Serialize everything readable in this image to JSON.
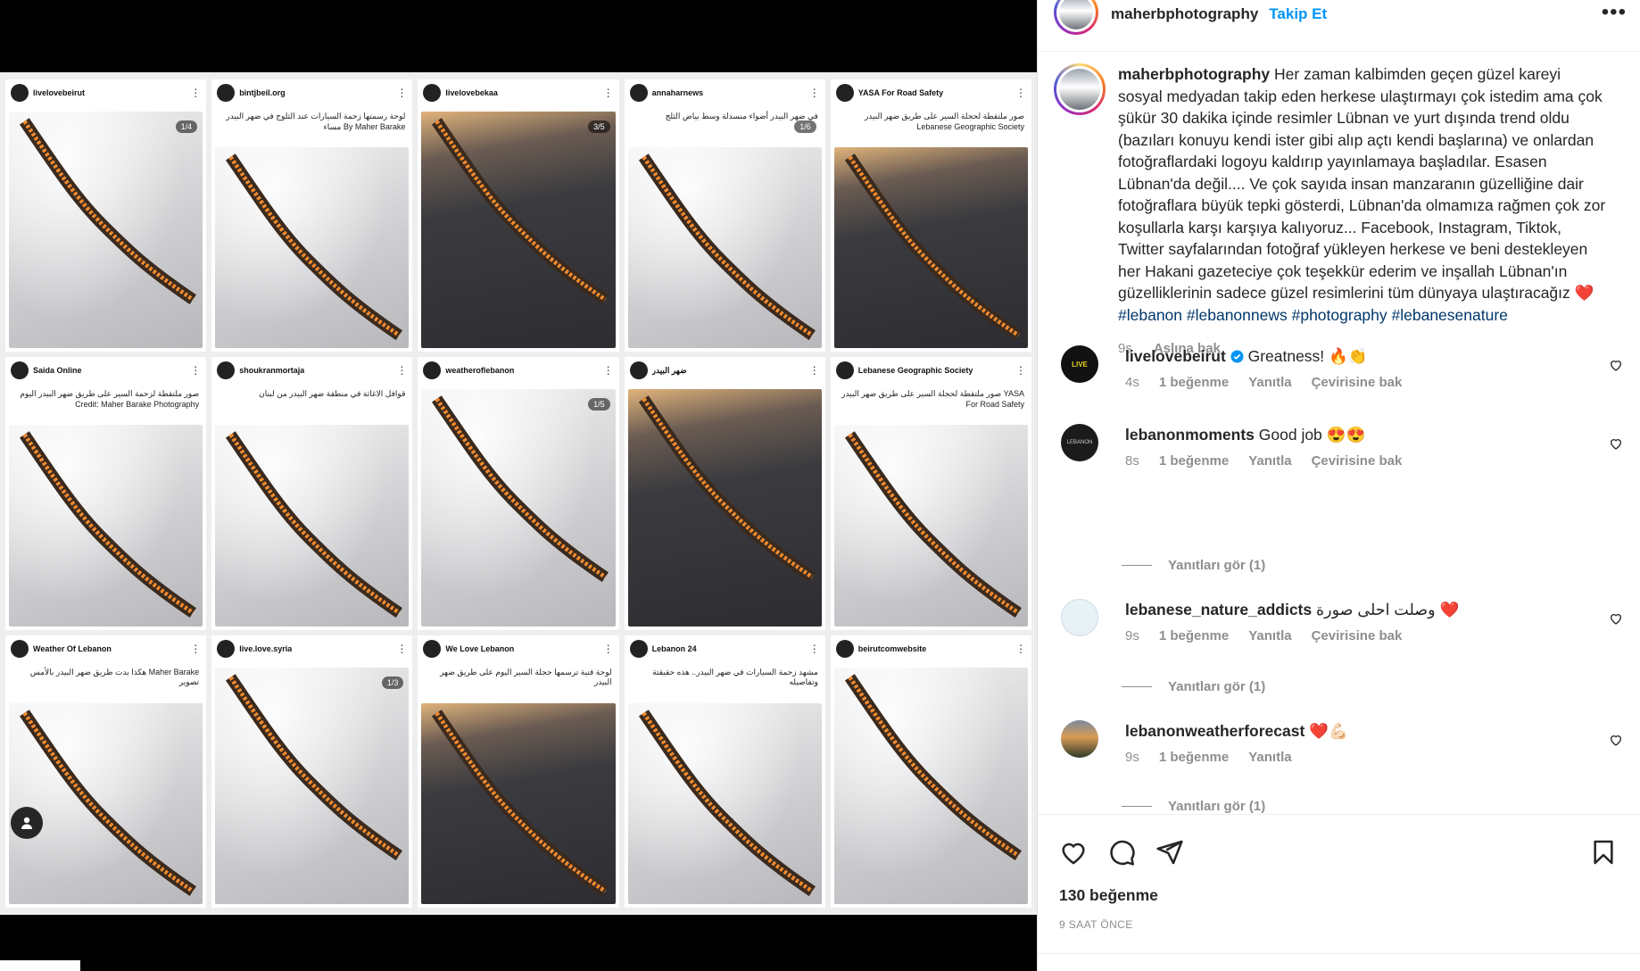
{
  "post": {
    "author": "maherbphotography",
    "follow_label": "Takip Et",
    "more_icon": "•••",
    "caption_text": " Her zaman kalbimden geçen güzel kareyi sosyal medyadan takip eden herkese ulaştırmayı çok istedim ama çok şükür 30 dakika içinde resimler Lübnan ve yurt dışında trend oldu (bazıları konuyu kendi ister gibi alıp açtı kendi başlarına) ve onlardan fotoğraflardaki logoyu kaldırıp yayınlamaya başladılar. Esasen Lübnan'da değil.... Ve çok sayıda insan manzaranın güzelliğine dair fotoğraflara büyük tepki gösterdi, Lübnan'da olmamıza rağmen çok zor koşullarla karşı karşıya kalıyoruz... Facebook, Instagram, Tiktok, Twitter sayfalarından fotoğraf yükleyen herkese ve beni destekleyen her Hakani gazeteciye çok teşekkür ederim ve inşallah Lübnan'ın güzelliklerinin sadece güzel resimlerini tüm dünyaya ulaştıracağız ",
    "caption_emoji": "❤️",
    "hashtags": "#lebanon #lebanonnews #photography #lebanesenature",
    "caption_time": "9s",
    "see_translation": "Aslına bak",
    "likes": "130 beğenme",
    "posted_ago": "9 SAAT ÖNCE"
  },
  "comments": [
    {
      "user": "livelovebeirut",
      "text": "Greatness! 🔥👏",
      "time": "4s",
      "likes": "1 beğenme",
      "reply": "Yanıtla",
      "translate": "Çevirisine bak",
      "avatar_color": "#111111"
    },
    {
      "user": "lebanonmoments",
      "text": "Good job 😍😍",
      "time": "8s",
      "likes": "1 beğenme",
      "reply": "Yanıtla",
      "translate": "Çevirisine bak",
      "replies": "Yanıtları gör (1)",
      "avatar_color": "#1b1b1b"
    },
    {
      "user": "lebanese_nature_addicts",
      "text": "وصلت احلى صورة ❤️",
      "time": "9s",
      "likes": "1 beğenme",
      "reply": "Yanıtla",
      "translate": "Çevirisine bak",
      "replies": "Yanıtları gör (1)",
      "avatar_color": "#e8f1f6"
    },
    {
      "user": "lebanonweatherforecast",
      "text": "❤️💪🏻",
      "time": "9s",
      "likes": "1 beğenme",
      "reply": "Yanıtla",
      "replies": "Yanıtları gör (1)",
      "avatar_color": "#3a4a34"
    }
  ],
  "grid_tiles": [
    {
      "account": "livelovebeirut",
      "badge": "1/4",
      "dark": false
    },
    {
      "account": "bintjbeil.org",
      "caption": "لوحة رسمتها زحمة السيارات عند الثلوج في ضهر البيدر مساء By Maher Barake",
      "dark": false
    },
    {
      "account": "livelovebekaa",
      "badge": "3/5",
      "dark": true
    },
    {
      "account": "annaharnews",
      "badge": "1/6",
      "dark": false,
      "caption": "في ضهر البيدر أضواء منسدلة وسط بياض الثلج"
    },
    {
      "account": "YASA For Road Safety",
      "caption": "صور ملتقطة لحجلة السير على طريق ضهر البيدر Lebanese Geographic Society",
      "dark": true
    },
    {
      "account": "Saida Online",
      "caption": "صور ملتقطة لزحمة السير على طريق ضهر البيدر اليوم Credit: Maher Barake Photography",
      "dark": false
    },
    {
      "account": "shoukranmortaja",
      "caption": "قوافل الاغاثة في منطقة ضهر البيدر من لبنان",
      "dark": false
    },
    {
      "account": "weatheroflebanon",
      "badge": "1/5",
      "dark": false
    },
    {
      "account": "ضهر البيدر",
      "dark": true
    },
    {
      "account": "Lebanese Geographic Society",
      "caption": "صور ملتقطة لحجلة السير على طريق ضهر البيدر YASA For Road Safety",
      "dark": false
    },
    {
      "account": "Weather Of Lebanon",
      "caption": "هكذا بدت طريق ضهر البيدر بالأمس Maher Barake تصوير",
      "dark": false
    },
    {
      "account": "live.love.syria",
      "badge": "1/3",
      "dark": false
    },
    {
      "account": "We Love Lebanon",
      "caption": "لوحة فنية ترسمها حجلة السير اليوم على طريق ضهر البيدر",
      "dark": true
    },
    {
      "account": "Lebanon 24",
      "caption": "مشهد زحمة السيارات في ضهر البيدر.. هذه حقيقتة وتفاصيله",
      "dark": false
    },
    {
      "account": "beirutcomwebsite",
      "dark": false
    }
  ],
  "colors": {
    "link": "#0095f6",
    "hashtag": "#00376b",
    "muted": "#8e8e8e",
    "heart": "#ed4956"
  }
}
